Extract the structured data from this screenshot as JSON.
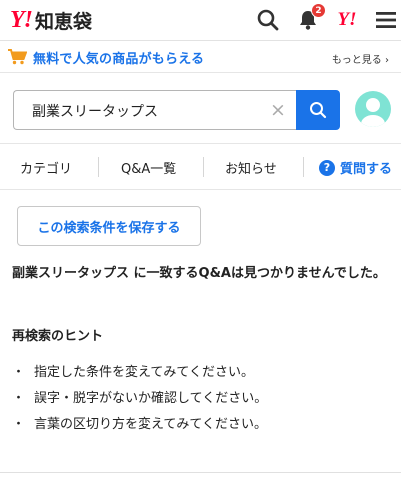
{
  "header": {
    "logo_mark": "Y!",
    "logo_text": "知恵袋",
    "notification_count": "2",
    "yahoo_mark": "Y!"
  },
  "promo": {
    "text": "無料で人気の商品がもらえる",
    "more": "もっと見る ›"
  },
  "search": {
    "value": "副業スリータップス",
    "clear": "×"
  },
  "nav": {
    "items": [
      "カテゴリ",
      "Q&A一覧",
      "お知らせ"
    ],
    "ask_label": "質問する",
    "ask_icon": "?"
  },
  "main": {
    "save_condition": "この検索条件を保存する",
    "no_result": "副業スリータップス に一致するQ&Aは見つかりませんでした。",
    "hint_title": "再検索のヒント",
    "hints": [
      "指定した条件を変えてみてください。",
      "誤字・脱字がないか確認してください。",
      "言葉の区切り方を変えてみてください。"
    ],
    "bullet": "・"
  },
  "colors": {
    "accent": "#1a73e8",
    "brand": "#ff0033",
    "badge": "#e53935",
    "avatar": "#7fe3d4"
  }
}
